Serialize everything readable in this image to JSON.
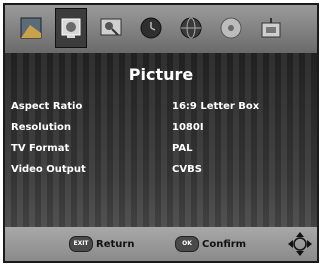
{
  "menu": {
    "tabs": [
      {
        "name": "channel-icon"
      },
      {
        "name": "picture-icon"
      },
      {
        "name": "search-icon"
      },
      {
        "name": "time-icon"
      },
      {
        "name": "language-icon"
      },
      {
        "name": "audio-icon"
      },
      {
        "name": "system-icon"
      }
    ],
    "title": "Picture",
    "rows": [
      {
        "label": "Aspect Ratio",
        "value": "16:9 Letter Box"
      },
      {
        "label": "Resolution",
        "value": "1080I"
      },
      {
        "label": "TV Format",
        "value": "PAL"
      },
      {
        "label": "Video Output",
        "value": "CVBS"
      }
    ]
  },
  "hints": {
    "exit_key": "EXIT",
    "exit_label": "Return",
    "ok_key": "OK",
    "ok_label": "Confirm"
  }
}
